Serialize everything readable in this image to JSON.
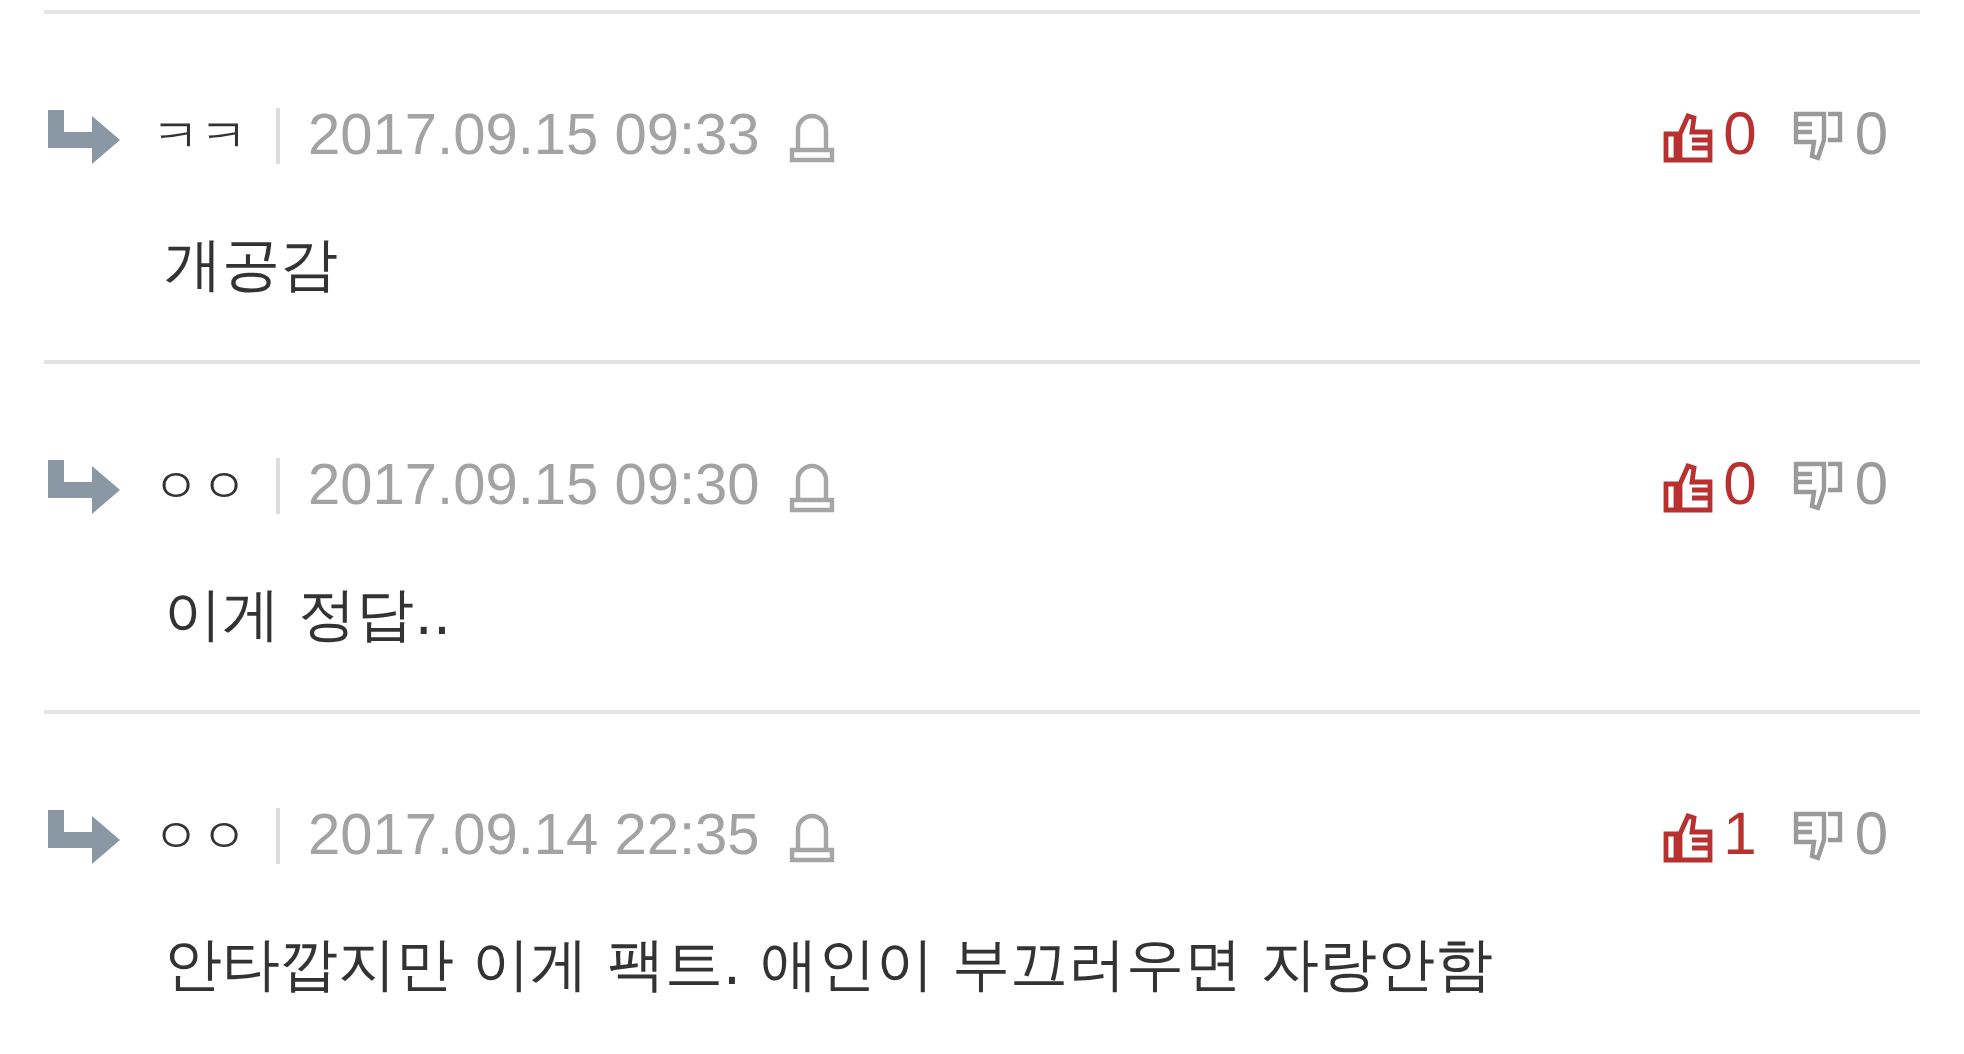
{
  "comments": [
    {
      "author": "ㅋㅋ",
      "date": "2017.09.15 09:33",
      "text": "개공감",
      "likes": "0",
      "dislikes": "0"
    },
    {
      "author": "ㅇㅇ",
      "date": "2017.09.15 09:30",
      "text": "이게 정답..",
      "likes": "0",
      "dislikes": "0"
    },
    {
      "author": "ㅇㅇ",
      "date": "2017.09.14 22:35",
      "text": "안타깝지만 이게 팩트. 애인이 부끄러우면 자랑안함",
      "likes": "1",
      "dislikes": "0"
    }
  ]
}
